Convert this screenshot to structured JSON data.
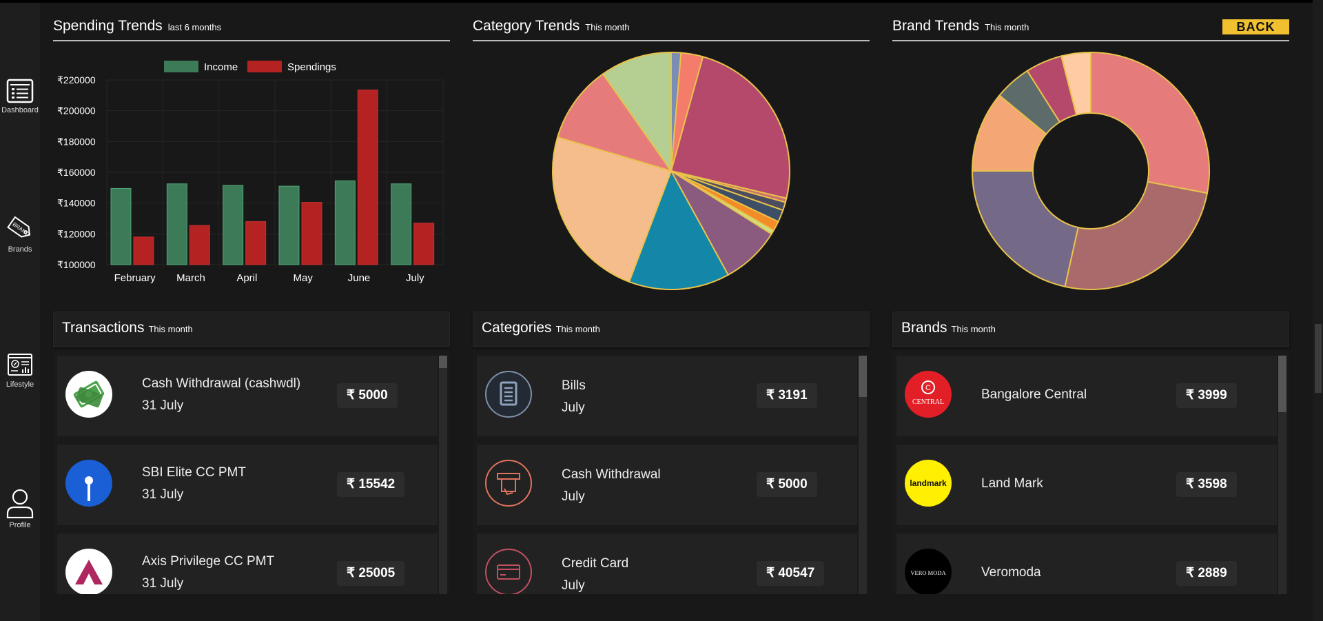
{
  "sidebar": {
    "items": [
      {
        "label": "Dashboard",
        "icon": "dashboard-icon"
      },
      {
        "label": "Brands",
        "icon": "brand-tag-icon"
      },
      {
        "label": "Lifestyle",
        "icon": "lifestyle-icon"
      },
      {
        "label": "Profile",
        "icon": "profile-icon"
      }
    ]
  },
  "panels": {
    "spending": {
      "title": "Spending Trends",
      "subtitle": "last 6 months"
    },
    "category": {
      "title": "Category Trends",
      "subtitle": "This month"
    },
    "brand": {
      "title": "Brand Trends",
      "subtitle": "This month",
      "back_label": "BACK"
    }
  },
  "chart_data": [
    {
      "type": "bar",
      "categories": [
        "February",
        "March",
        "April",
        "May",
        "June",
        "July"
      ],
      "series": [
        {
          "name": "Income",
          "values": [
            149500,
            152500,
            151500,
            151000,
            154500,
            152500
          ],
          "color": "#3d7a57"
        },
        {
          "name": "Spendings",
          "values": [
            118000,
            125500,
            128000,
            140500,
            213500,
            127000
          ],
          "color": "#b52222"
        }
      ],
      "ylim": [
        100000,
        220000
      ],
      "yticks": [
        "₹100000",
        "₹120000",
        "₹140000",
        "₹160000",
        "₹180000",
        "₹200000",
        "₹220000"
      ],
      "grid": true,
      "legend": "top"
    },
    {
      "type": "pie",
      "values": [
        1.2,
        2.7,
        22.0,
        0.5,
        1.0,
        1.5,
        1.2,
        0.5,
        7.3,
        12.4,
        21.5,
        9.6,
        8.8
      ],
      "colors": [
        "#7b8db5",
        "#f47c6a",
        "#b5496c",
        "#cc6d6d",
        "#4c4c60",
        "#3d4f66",
        "#f28c28",
        "#c7e28a",
        "#8a5a7f",
        "#1487a8",
        "#f6bd8c",
        "#e57b7b",
        "#b4cf91"
      ]
    },
    {
      "type": "pie",
      "donut": true,
      "values": [
        28.0,
        25.5,
        21.5,
        11.0,
        5.0,
        5.0,
        4.0
      ],
      "colors": [
        "#e57b7b",
        "#a86a6a",
        "#756988",
        "#f4a774",
        "#5e6b6b",
        "#b5496c",
        "#ffcba4"
      ]
    }
  ],
  "transactions": {
    "title": "Transactions",
    "subtitle": "This month",
    "items": [
      {
        "name": "Cash Withdrawal (cashwdl)",
        "date": "31 July",
        "amount": "₹ 5000"
      },
      {
        "name": "SBI Elite CC PMT",
        "date": "31 July",
        "amount": "₹ 15542"
      },
      {
        "name": "Axis Privilege CC PMT",
        "date": "31 July",
        "amount": "₹ 25005"
      }
    ]
  },
  "categories": {
    "title": "Categories",
    "subtitle": "This month",
    "items": [
      {
        "name": "Bills",
        "period": "July",
        "amount": "₹ 3191"
      },
      {
        "name": "Cash Withdrawal",
        "period": "July",
        "amount": "₹ 5000"
      },
      {
        "name": "Credit Card",
        "period": "July",
        "amount": "₹ 40547"
      }
    ]
  },
  "brands": {
    "title": "Brands",
    "subtitle": "This month",
    "items": [
      {
        "name": "Bangalore Central",
        "amount": "₹ 3999",
        "logo_text": "CENTRAL",
        "logo_color": "#e21f26"
      },
      {
        "name": "Land Mark",
        "amount": "₹ 3598",
        "logo_text": "landmark",
        "logo_color": "#ffef00"
      },
      {
        "name": "Veromoda",
        "amount": "₹ 2889",
        "logo_text": "VERO MODA",
        "logo_color": "#000000"
      }
    ]
  }
}
